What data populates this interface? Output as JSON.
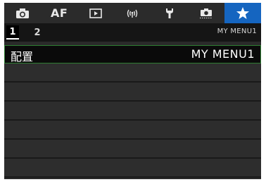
{
  "tabs": [
    {
      "name": "camera-icon",
      "label": ""
    },
    {
      "name": "af",
      "label": "AF"
    },
    {
      "name": "playback-icon",
      "label": ""
    },
    {
      "name": "wireless-icon",
      "label": ""
    },
    {
      "name": "wrench-icon",
      "label": ""
    },
    {
      "name": "camera-settings-icon",
      "label": ""
    },
    {
      "name": "star-icon",
      "label": ""
    }
  ],
  "active_tab": "star",
  "subtabs": {
    "one": "1",
    "two": "2",
    "active": "1"
  },
  "page_name": "MY MENU1",
  "menu": {
    "items": [
      {
        "label": "配置",
        "value": "MY MENU1",
        "selected": true
      }
    ],
    "empty_rows": 6
  },
  "colors": {
    "active_tab": "#1565c0",
    "selection_border": "#2e7d32",
    "background": "#2d2d2d"
  }
}
